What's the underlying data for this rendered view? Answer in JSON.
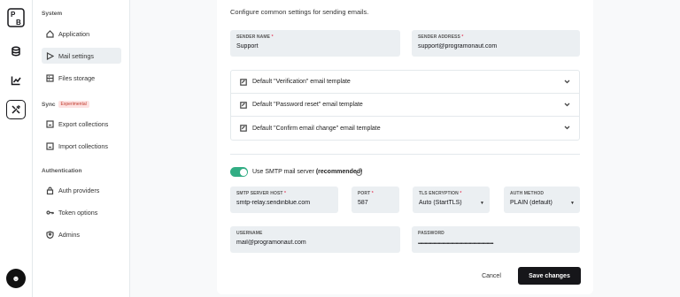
{
  "app": {
    "logo_text": "PB"
  },
  "rail": {
    "items": [
      "database-icon",
      "chart-icon",
      "tools-icon"
    ],
    "active": "tools-icon"
  },
  "sidebar": {
    "system_title": "System",
    "system_items": [
      {
        "label": "Application",
        "icon": "home-icon"
      },
      {
        "label": "Mail settings",
        "icon": "send-icon",
        "active": true
      },
      {
        "label": "Files storage",
        "icon": "storage-icon"
      }
    ],
    "sync_title": "Sync",
    "sync_badge": "Experimental",
    "sync_items": [
      {
        "label": "Export collections",
        "icon": "export-icon"
      },
      {
        "label": "Import collections",
        "icon": "import-icon"
      }
    ],
    "auth_title": "Authentication",
    "auth_items": [
      {
        "label": "Auth providers",
        "icon": "lock-icon"
      },
      {
        "label": "Token options",
        "icon": "key-icon"
      },
      {
        "label": "Admins",
        "icon": "shield-icon"
      }
    ]
  },
  "main": {
    "intro": "Configure common settings for sending emails.",
    "sender_name": {
      "label": "SENDER NAME",
      "req": "*",
      "value": "Support"
    },
    "sender_address": {
      "label": "SENDER ADDRESS",
      "req": "*",
      "value": "support@programonaut.com"
    },
    "templates": [
      "Default \"Verification\" email template",
      "Default \"Password reset\" email template",
      "Default \"Confirm email change\" email template"
    ],
    "smtp_toggle": {
      "text": "Use SMTP mail server ",
      "bold": "(recommended)",
      "on": true
    },
    "smtp_host": {
      "label": "SMTP SERVER HOST",
      "req": "*",
      "value": "smtp-relay.sendinblue.com"
    },
    "port": {
      "label": "PORT",
      "req": "*",
      "value": "587"
    },
    "tls": {
      "label": "TLS ENCRYPTION",
      "req": "*",
      "value": "Auto (StartTLS)"
    },
    "auth_method": {
      "label": "AUTH METHOD",
      "value": "PLAIN (default)"
    },
    "username": {
      "label": "USERNAME",
      "value": "mail@programonaut.com"
    },
    "password": {
      "label": "PASSWORD",
      "value": "••••••••••••••••••••••••••••••••••••••••••••••••••••••••••••••••••••"
    },
    "cancel_label": "Cancel",
    "save_label": "Save changes"
  },
  "colors": {
    "accent_toggle": "#32ad84",
    "primary_button": "#16161a",
    "required": "#e34562"
  }
}
